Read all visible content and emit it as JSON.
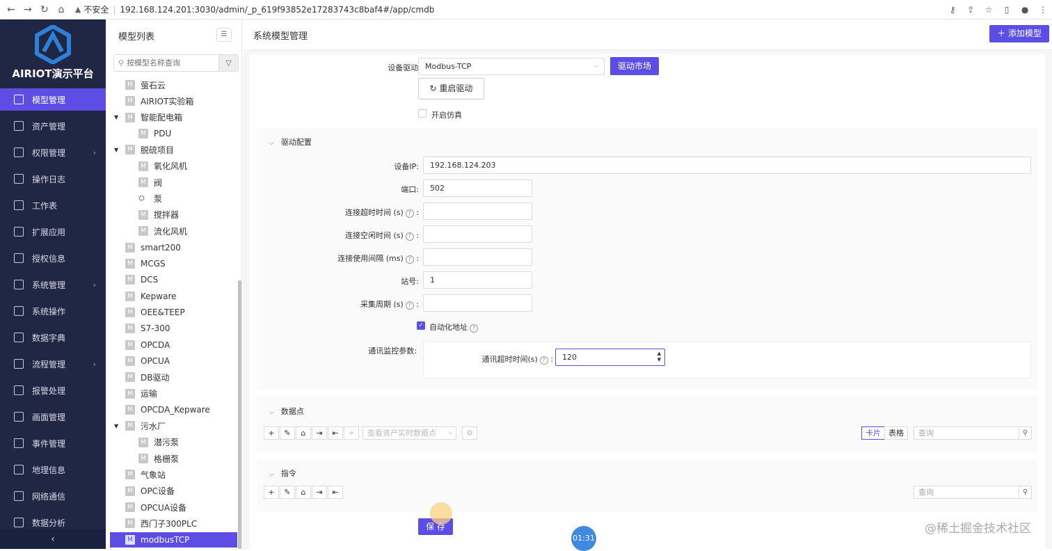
{
  "browser": {
    "insecure_label": "不安全",
    "url": "192.168.124.201:3030/admin/_p_619f93852e17283743c8baf4#/app/cmdb"
  },
  "sidebar": {
    "brand": "AIRIOT演示平台",
    "items": [
      {
        "label": "模型管理",
        "icon": "model-icon",
        "active": true
      },
      {
        "label": "资产管理",
        "icon": "asset-icon"
      },
      {
        "label": "权限管理",
        "icon": "lock-icon",
        "has_arrow": true
      },
      {
        "label": "操作日志",
        "icon": "log-icon"
      },
      {
        "label": "工作表",
        "icon": "sheet-icon"
      },
      {
        "label": "扩展应用",
        "icon": "app-icon"
      },
      {
        "label": "授权信息",
        "icon": "license-icon"
      },
      {
        "label": "系统管理",
        "icon": "gear-icon",
        "has_arrow": true
      },
      {
        "label": "系统操作",
        "icon": "operation-icon"
      },
      {
        "label": "数据字典",
        "icon": "dictionary-icon"
      },
      {
        "label": "流程管理",
        "icon": "flow-icon",
        "has_arrow": true
      },
      {
        "label": "报警处理",
        "icon": "alarm-icon"
      },
      {
        "label": "画面管理",
        "icon": "screen-icon"
      },
      {
        "label": "事件管理",
        "icon": "event-icon"
      },
      {
        "label": "地理信息",
        "icon": "map-icon"
      },
      {
        "label": "网络通信",
        "icon": "network-icon"
      },
      {
        "label": "数据分析",
        "icon": "analysis-icon"
      }
    ]
  },
  "tree": {
    "title": "模型列表",
    "search_placeholder": "按模型名称查询",
    "items": [
      {
        "label": "萤石云",
        "level": 0
      },
      {
        "label": "AIRIOT实验箱",
        "level": 0
      },
      {
        "label": "智能配电箱",
        "level": 0,
        "expanded": true
      },
      {
        "label": "PDU",
        "level": 1
      },
      {
        "label": "脱硫项目",
        "level": 0,
        "expanded": true
      },
      {
        "label": "氧化风机",
        "level": 1
      },
      {
        "label": "阀",
        "level": 1
      },
      {
        "label": "泵",
        "level": 1,
        "special_icon": true
      },
      {
        "label": "搅拌器",
        "level": 1
      },
      {
        "label": "流化风机",
        "level": 1
      },
      {
        "label": "smart200",
        "level": 0
      },
      {
        "label": "MCGS",
        "level": 0
      },
      {
        "label": "DCS",
        "level": 0
      },
      {
        "label": "Kepware",
        "level": 0
      },
      {
        "label": "OEE&TEEP",
        "level": 0
      },
      {
        "label": "S7-300",
        "level": 0
      },
      {
        "label": "OPCDA",
        "level": 0
      },
      {
        "label": "OPCUA",
        "level": 0
      },
      {
        "label": "DB驱动",
        "level": 0
      },
      {
        "label": "运输",
        "level": 0
      },
      {
        "label": "OPCDA_Kepware",
        "level": 0
      },
      {
        "label": "污水厂",
        "level": 0,
        "expanded": true
      },
      {
        "label": "潜污泵",
        "level": 1
      },
      {
        "label": "格栅泵",
        "level": 1
      },
      {
        "label": "气象站",
        "level": 0
      },
      {
        "label": "OPC设备",
        "level": 0
      },
      {
        "label": "OPCUA设备",
        "level": 0
      },
      {
        "label": "西门子300PLC",
        "level": 0
      },
      {
        "label": "modbusTCP",
        "level": 0,
        "selected": true
      }
    ]
  },
  "main": {
    "title": "系统模型管理",
    "add_model": "添加模型",
    "driver_label": "设备驱动:",
    "driver_value": "Modbus-TCP",
    "driver_market": "驱动市场",
    "restart_driver": "重启驱动",
    "simulation_label": "开启仿真",
    "driver_config": {
      "title": "驱动配置",
      "fields": [
        {
          "label": "设备IP:",
          "value": "192.168.124.203"
        },
        {
          "label": "端口:",
          "value": "502"
        },
        {
          "label": "连接超时时间 (s)",
          "value": "",
          "help": true
        },
        {
          "label": "连接空闲时间 (s)",
          "value": "",
          "help": true
        },
        {
          "label": "连接使用间隔 (ms)",
          "value": "",
          "help": true
        },
        {
          "label": "站号:",
          "value": "1"
        },
        {
          "label": "采集周期 (s)",
          "value": "",
          "help": true
        }
      ],
      "auto_address": "自动化地址",
      "monitor_label": "通讯监控参数:",
      "timeout_label": "通讯超时时间(s)",
      "timeout_value": "120"
    },
    "datapoints": {
      "title": "数据点",
      "asset_select_placeholder": "查看资产实时数据点",
      "view_card": "卡片",
      "view_table": "表格",
      "search_placeholder": "查询"
    },
    "commands": {
      "title": "指令",
      "search_placeholder": "查询"
    },
    "save": "保 存",
    "timer": "01:31",
    "watermark": "@稀土掘金技术社区"
  }
}
